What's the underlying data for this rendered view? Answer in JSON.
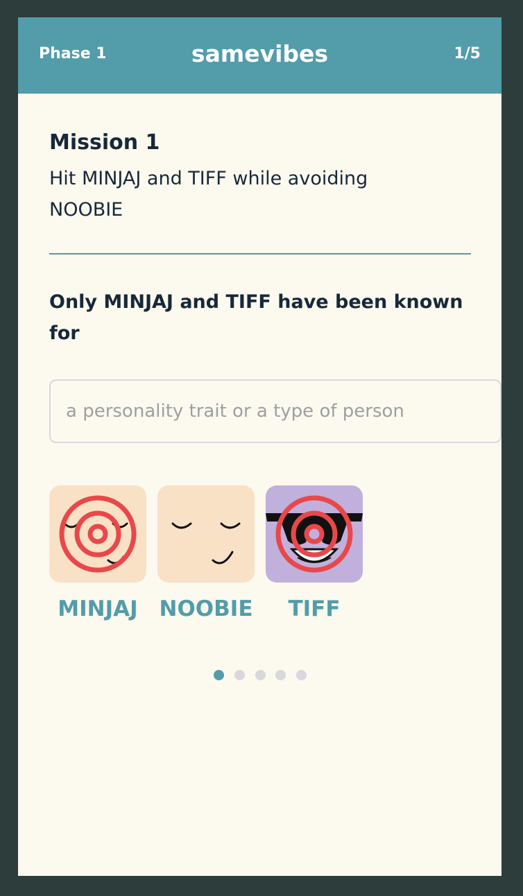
{
  "header": {
    "phase_label": "Phase 1",
    "app_title": "samevibes",
    "progress": "1/5"
  },
  "mission": {
    "title": "Mission 1",
    "description": "Hit MINJAJ and TIFF while avoiding NOOBIE"
  },
  "prompt": {
    "text": "Only MINJAJ and TIFF have been known for"
  },
  "answer_input": {
    "value": "",
    "placeholder": "a personality trait or a type of person"
  },
  "characters": [
    {
      "name": "MINJAJ",
      "targeted": true,
      "face": "sleepy-face"
    },
    {
      "name": "NOOBIE",
      "targeted": false,
      "face": "sleepy-face"
    },
    {
      "name": "TIFF",
      "targeted": true,
      "face": "sunglasses-face"
    }
  ],
  "pagination": {
    "total": 5,
    "current": 1
  },
  "colors": {
    "accent": "#539caa",
    "target": "#e8484a",
    "peach_avatar": "#f9e1c6",
    "purple_avatar": "#c1b0dc",
    "card_bg": "#fcf9ee",
    "frame_bg": "#2d3d3b"
  }
}
